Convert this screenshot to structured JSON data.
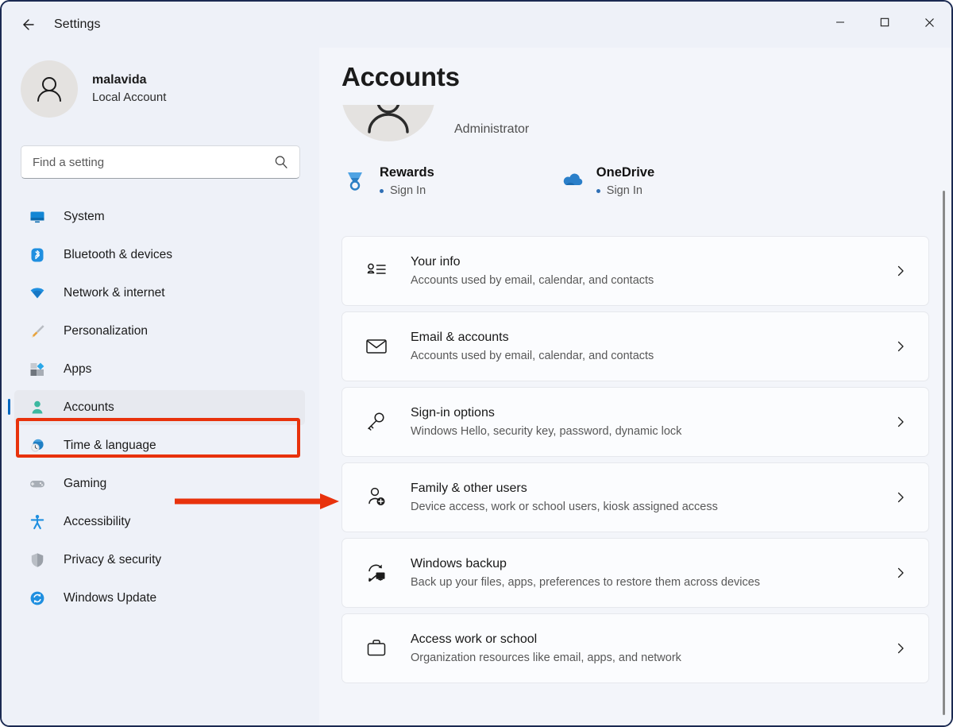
{
  "window": {
    "title": "Settings",
    "back_icon": "back-arrow-icon",
    "controls": {
      "minimize": "minimize-icon",
      "maximize": "maximize-icon",
      "close": "close-icon"
    }
  },
  "sidebar": {
    "profile": {
      "name": "malavida",
      "account_type": "Local Account",
      "avatar_icon": "user-avatar-icon"
    },
    "search": {
      "placeholder": "Find a setting",
      "value": "",
      "icon": "search-icon"
    },
    "items": [
      {
        "label": "System",
        "icon": "monitor-icon",
        "selected": false
      },
      {
        "label": "Bluetooth & devices",
        "icon": "bluetooth-icon",
        "selected": false
      },
      {
        "label": "Network & internet",
        "icon": "wifi-icon",
        "selected": false
      },
      {
        "label": "Personalization",
        "icon": "paintbrush-icon",
        "selected": false
      },
      {
        "label": "Apps",
        "icon": "apps-icon",
        "selected": false
      },
      {
        "label": "Accounts",
        "icon": "person-icon",
        "selected": true
      },
      {
        "label": "Time & language",
        "icon": "clock-globe-icon",
        "selected": false
      },
      {
        "label": "Gaming",
        "icon": "gamepad-icon",
        "selected": false
      },
      {
        "label": "Accessibility",
        "icon": "accessibility-icon",
        "selected": false
      },
      {
        "label": "Privacy & security",
        "icon": "shield-icon",
        "selected": false
      },
      {
        "label": "Windows Update",
        "icon": "update-icon",
        "selected": false
      }
    ]
  },
  "main": {
    "page_title": "Accounts",
    "hero": {
      "role": "Administrator",
      "avatar_icon": "user-avatar-large-icon"
    },
    "services": [
      {
        "name": "Rewards",
        "status": "Sign In",
        "icon": "rewards-medal-icon"
      },
      {
        "name": "OneDrive",
        "status": "Sign In",
        "icon": "onedrive-cloud-icon"
      }
    ],
    "cards": [
      {
        "title": "Your info",
        "subtitle": "Accounts used by email, calendar, and contacts",
        "icon": "contact-card-icon",
        "chevron": "chevron-right-icon"
      },
      {
        "title": "Email & accounts",
        "subtitle": "Accounts used by email, calendar, and contacts",
        "icon": "envelope-icon",
        "chevron": "chevron-right-icon"
      },
      {
        "title": "Sign-in options",
        "subtitle": "Windows Hello, security key, password, dynamic lock",
        "icon": "key-icon",
        "chevron": "chevron-right-icon"
      },
      {
        "title": "Family & other users",
        "subtitle": "Device access, work or school users, kiosk assigned access",
        "icon": "person-add-icon",
        "chevron": "chevron-right-icon"
      },
      {
        "title": "Windows backup",
        "subtitle": "Back up your files, apps, preferences to restore them across devices",
        "icon": "backup-icon",
        "chevron": "chevron-right-icon"
      },
      {
        "title": "Access work or school",
        "subtitle": "Organization resources like email, apps, and network",
        "icon": "briefcase-icon",
        "chevron": "chevron-right-icon"
      }
    ]
  },
  "annotations": {
    "highlight_color": "#e8320c",
    "highlight_target": "Accounts",
    "arrow_target": "Family & other users"
  },
  "colors": {
    "accent": "#0067c0",
    "page_background": "#f3f5fa",
    "sidebar_background": "#eef1f8",
    "card_background": "#fbfcfe",
    "annotation_red": "#e8320c"
  }
}
